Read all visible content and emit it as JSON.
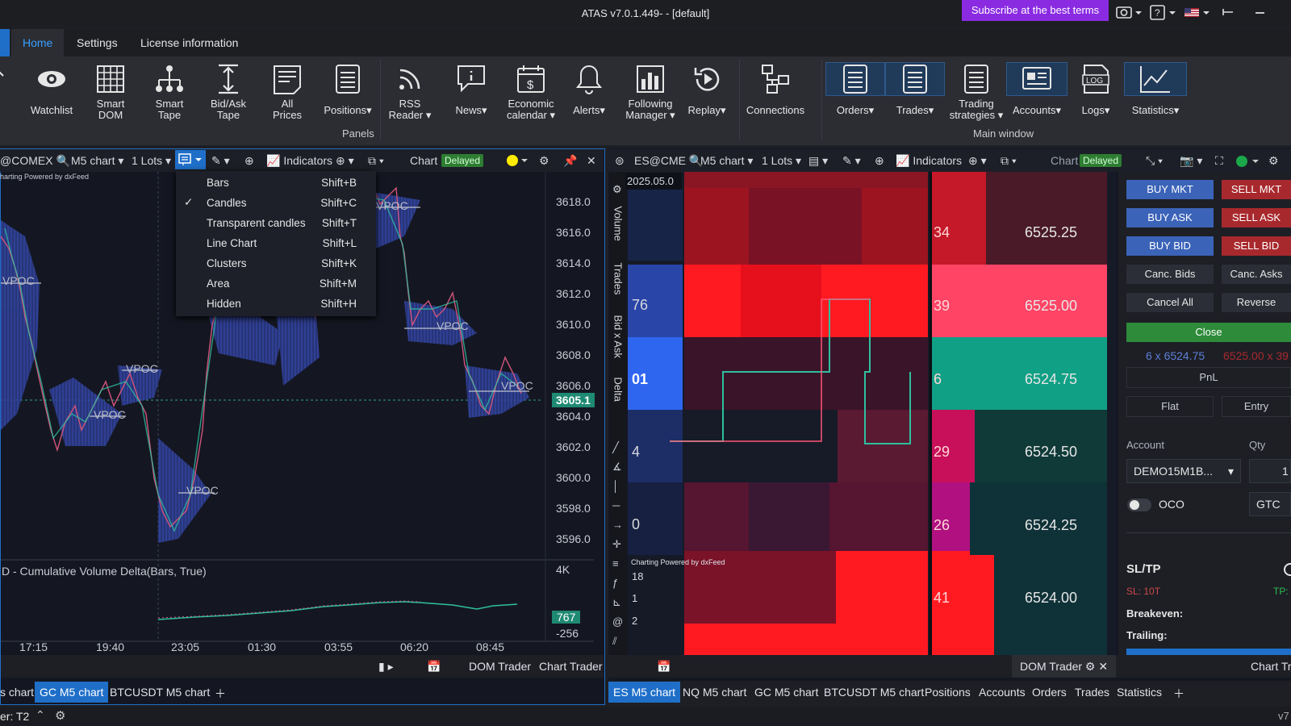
{
  "window": {
    "title": "ATAS v7.0.1.449- - [default]",
    "subscribe": "Subscribe at the best terms"
  },
  "menu": {
    "tabs": [
      "Home",
      "Settings",
      "License information"
    ]
  },
  "ribbon": {
    "buttons": [
      {
        "label": "Watchlist",
        "icon": "eye-icon"
      },
      {
        "label": "Smart\nDOM",
        "icon": "grid-icon"
      },
      {
        "label": "Smart\nTape",
        "icon": "hierarchy-icon"
      },
      {
        "label": "Bid/Ask\nTape",
        "icon": "arrows-vertical-icon"
      },
      {
        "label": "All\nPrices",
        "icon": "document-list-icon"
      },
      {
        "label": "Positions",
        "icon": "list-icon"
      },
      {
        "label": "RSS\nReader",
        "icon": "rss-icon"
      },
      {
        "label": "News",
        "icon": "chat-info-icon"
      },
      {
        "label": "Economic\ncalendar",
        "icon": "calendar-dollar-icon"
      },
      {
        "label": "Alerts",
        "icon": "bell-icon"
      },
      {
        "label": "Following\nManager",
        "icon": "bar-chart-icon"
      },
      {
        "label": "Replay",
        "icon": "replay-icon"
      },
      {
        "label": "Connections",
        "icon": "network-icon"
      },
      {
        "label": "Orders",
        "icon": "list-icon"
      },
      {
        "label": "Trades",
        "icon": "list-icon"
      },
      {
        "label": "Trading\nstrategies",
        "icon": "list-icon"
      },
      {
        "label": "Accounts",
        "icon": "id-card-icon"
      },
      {
        "label": "Logs",
        "icon": "log-file-icon"
      },
      {
        "label": "Statistics",
        "icon": "line-chart-icon"
      }
    ],
    "groups": {
      "panels": "Panels",
      "main": "Main window"
    }
  },
  "left_chart": {
    "symbol": "@COMEX",
    "timeframe": "M5 chart",
    "lots": "1 Lots",
    "indicators": "Indicators",
    "chart_label": "Chart",
    "delayed": "Delayed",
    "powered": "harting Powered by dxFeed",
    "yticks": [
      "3618.0",
      "3616.0",
      "3614.0",
      "3612.0",
      "3610.0",
      "3608.0",
      "3606.0",
      "3604.0",
      "3602.0",
      "3600.0",
      "3598.0",
      "3596.0"
    ],
    "current_price": "3605.1",
    "poc_labels": [
      "VPOC",
      "VPOC",
      "VPOC",
      "VPOC",
      "VPOC",
      "VPOC",
      "VPOC"
    ],
    "indicator_title": "D - Cumulative Volume Delta(Bars, True)",
    "ind_ticks": [
      "4K",
      "-256"
    ],
    "ind_value": "767",
    "xticks": [
      "17:15",
      "19:40",
      "23:05",
      "01:30",
      "03:55",
      "06:20",
      "08:45"
    ],
    "bottom": [
      "DOM Trader",
      "Chart Trader"
    ],
    "tabs": [
      "s chart",
      "GC M5 chart",
      "BTCUSDT M5 chart"
    ]
  },
  "context_menu": {
    "items": [
      {
        "name": "Bars",
        "key": "Shift+B",
        "checked": false
      },
      {
        "name": "Candles",
        "key": "Shift+C",
        "checked": true
      },
      {
        "name": "Transparent candles",
        "key": "Shift+T",
        "checked": false
      },
      {
        "name": "Line Chart",
        "key": "Shift+L",
        "checked": false
      },
      {
        "name": "Clusters",
        "key": "Shift+K",
        "checked": false
      },
      {
        "name": "Area",
        "key": "Shift+M",
        "checked": false
      },
      {
        "name": "Hidden",
        "key": "Shift+H",
        "checked": false
      }
    ]
  },
  "right_chart": {
    "symbol": "ES@CME",
    "timeframe": "M5 chart",
    "lots": "1 Lots",
    "indicators": "Indicators",
    "chart_label": "Chart",
    "delayed": "Delayed",
    "date": "2025.05.0",
    "side_labels": [
      "Volume",
      "Trades",
      "Bid x Ask",
      "Delta"
    ],
    "powered": "Charting Powered by dxFeed",
    "left_vals": [
      "76",
      "01",
      "4",
      "0",
      "18",
      "1",
      "2"
    ],
    "rows": [
      {
        "vol": "34",
        "price": "6525.25"
      },
      {
        "vol": "39",
        "price": "6525.00"
      },
      {
        "vol": "6",
        "price": "6524.75"
      },
      {
        "vol": "29",
        "price": "6524.50"
      },
      {
        "vol": "26",
        "price": "6524.25"
      },
      {
        "vol": "41",
        "price": "6524.00"
      }
    ],
    "bottom": "DOM Trader",
    "tabs": [
      "ES M5 chart",
      "NQ M5 chart",
      "GC M5 chart",
      "BTCUSDT M5 chart",
      "Positions",
      "Accounts",
      "Orders",
      "Trades",
      "Statistics"
    ]
  },
  "trade_panel": {
    "buy_mkt": "BUY MKT",
    "sell_mkt": "SELL MKT",
    "buy_ask": "BUY ASK",
    "sell_ask": "SELL ASK",
    "buy_bid": "BUY BID",
    "sell_bid": "SELL BID",
    "canc_bids": "Canc. Bids",
    "canc_asks": "Canc. Asks",
    "cancel_all": "Cancel All",
    "reverse": "Reverse",
    "close": "Close",
    "pos_left": "6 x 6524.75",
    "pos_right": "6525.00 x 39",
    "pnl": "PnL",
    "flat": "Flat",
    "entry": "Entry",
    "account_label": "Account",
    "qty_label": "Qty",
    "account": "DEMO15M1B...",
    "qty": "1",
    "oco": "OCO",
    "tif": "GTC",
    "sltp": "SL/TP",
    "sl": "SL: 10T",
    "tp": "TP:",
    "breakeven": "Breakeven:",
    "trailing": "Trailing:",
    "chart_tr": "Chart Tr"
  },
  "status": {
    "server": "er: T2",
    "version": "v7"
  }
}
